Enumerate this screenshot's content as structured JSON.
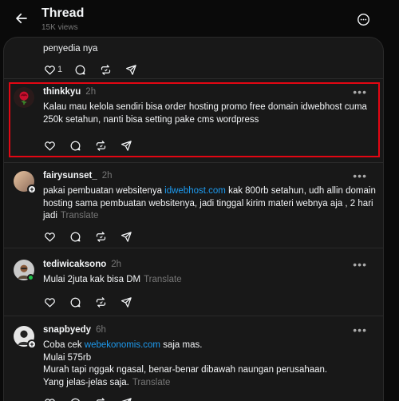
{
  "header": {
    "title": "Thread",
    "views": "15K views",
    "icons": {
      "back": "arrow-left-icon",
      "more": "more-circle-icon"
    }
  },
  "top_post": {
    "text_tail": "penyedia nya",
    "like_count": "1"
  },
  "replies": [
    {
      "username": "thinkkyu",
      "time": "2h",
      "text": "Kalau mau kelola sendiri bisa order hosting promo free domain idwebhost cuma 250k setahun, nanti bisa setting pake cms wordpress"
    },
    {
      "username": "fairysunset_",
      "time": "2h",
      "text_before": "pakai pembuatan websitenya ",
      "link": "idwebhost.com",
      "text_after": " kak 800rb setahun, udh allin domain hosting sama pembuatan websitenya, jadi tinggal kirim materi webnya aja , 2 hari jadi",
      "translate": "Translate"
    },
    {
      "username": "tediwicaksono",
      "time": "2h",
      "text": "Mulai 2juta kak bisa DM",
      "translate": "Translate"
    },
    {
      "username": "snapbyedy",
      "time": "6h",
      "text_before": "Coba cek ",
      "link": "webekonomis.com",
      "text_after": " saja mas.",
      "line2": "Mulai 575rb",
      "line3": "Murah tapi nggak ngasal, benar-benar dibawah naungan perusahaan.",
      "line4": "Yang jelas-jelas saja.",
      "translate": "Translate"
    }
  ],
  "colors": {
    "background": "#0a0a0a",
    "panel": "#181818",
    "link": "#1d9bf0",
    "highlight": "#e30613",
    "online": "#1ec14a"
  },
  "action_icons": [
    "heart-icon",
    "comment-icon",
    "repost-icon",
    "share-icon"
  ]
}
